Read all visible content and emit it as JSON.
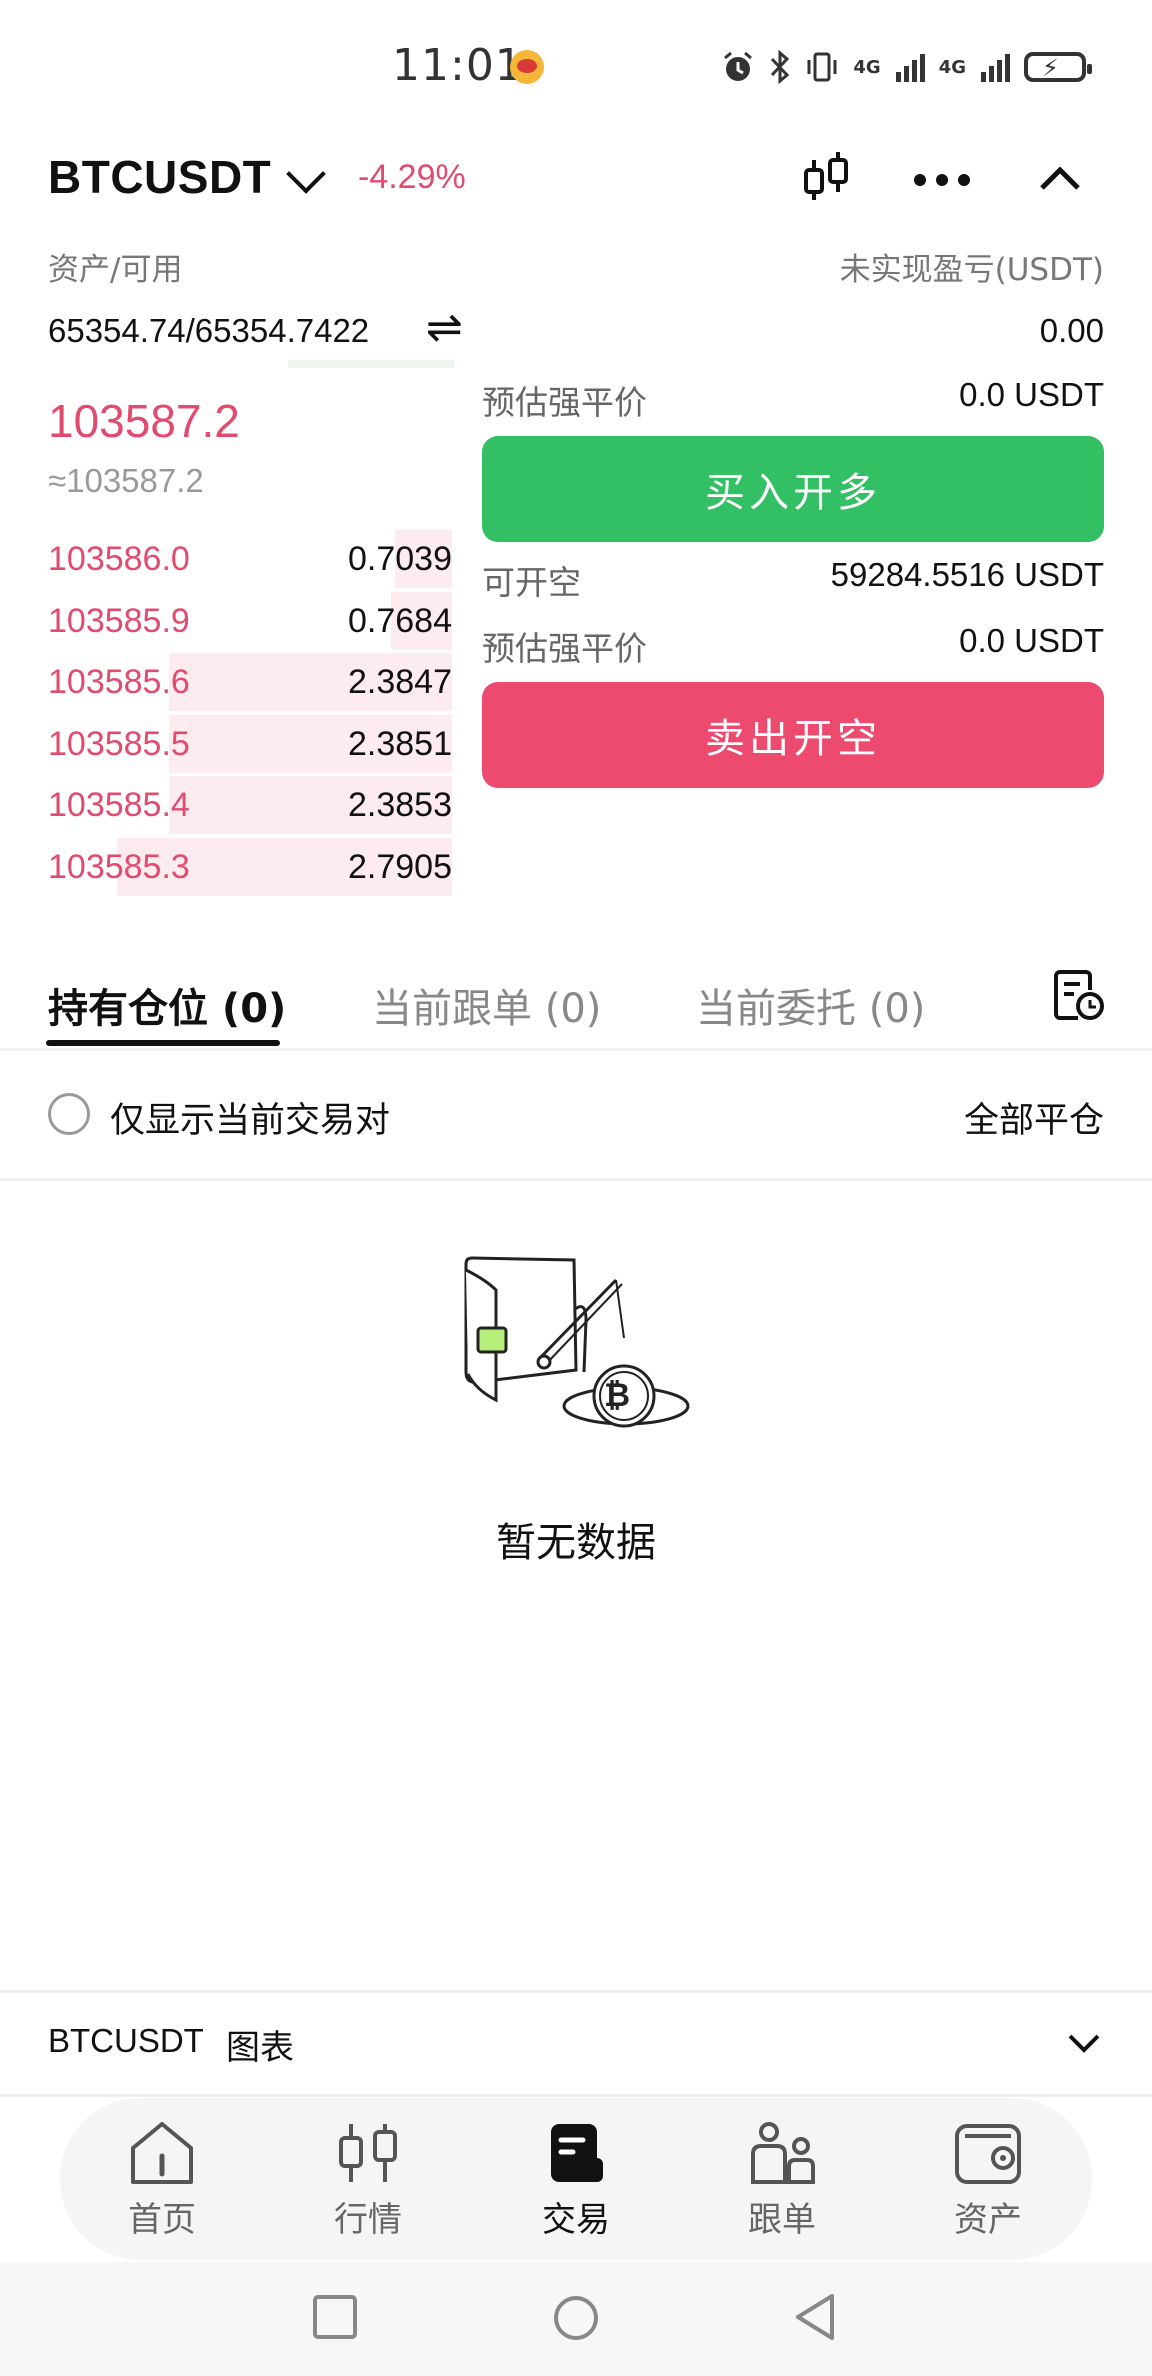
{
  "status_bar": {
    "time": "11:01",
    "signal_1": "4G",
    "signal_2": "4G"
  },
  "header": {
    "symbol": "BTCUSDT",
    "change": "-4.29%"
  },
  "account": {
    "assets_label": "资产/可用",
    "assets_value": "65354.74/65354.7422",
    "swap_glyph": "⇌",
    "pnl_label": "未实现盈亏(USDT)",
    "pnl_value": "0.00"
  },
  "price": {
    "last": "103587.2",
    "approx": "≈103587.2"
  },
  "order_book": [
    {
      "price": "103586.0",
      "qty": "0.7039",
      "depth": 0.14
    },
    {
      "price": "103585.9",
      "qty": "0.7684",
      "depth": 0.15
    },
    {
      "price": "103585.6",
      "qty": "2.3847",
      "depth": 0.7
    },
    {
      "price": "103585.5",
      "qty": "2.3851",
      "depth": 0.7
    },
    {
      "price": "103585.4",
      "qty": "2.3853",
      "depth": 0.7
    },
    {
      "price": "103585.3",
      "qty": "2.7905",
      "depth": 0.83
    }
  ],
  "trade": {
    "liq_label_1": "预估强平价",
    "liq_value_1": "0.0 USDT",
    "buy_label": "买入开多",
    "short_label": "可开空",
    "short_value": "59284.5516 USDT",
    "liq_label_2": "预估强平价",
    "liq_value_2": "0.0 USDT",
    "sell_label": "卖出开空"
  },
  "tabs": [
    {
      "label": "持有仓位 (0)",
      "active": true
    },
    {
      "label": "当前跟单 (0)",
      "active": false
    },
    {
      "label": "当前委托 (0)",
      "active": false
    }
  ],
  "filters": {
    "only_current_pair": "仅显示当前交易对",
    "close_all": "全部平仓"
  },
  "empty_state": {
    "text": "暂无数据",
    "coin_symbol": "₿"
  },
  "chart_bar": {
    "symbol": "BTCUSDT",
    "label": "图表"
  },
  "bottom_nav": [
    {
      "label": "首页",
      "icon": "home-icon",
      "active": false
    },
    {
      "label": "行情",
      "icon": "candlestick-icon",
      "active": false
    },
    {
      "label": "交易",
      "icon": "trade-icon",
      "active": true
    },
    {
      "label": "跟单",
      "icon": "copy-trade-icon",
      "active": false
    },
    {
      "label": "资产",
      "icon": "wallet-icon",
      "active": false
    }
  ],
  "colors": {
    "up": "#33bf63",
    "down": "#ec4b6f",
    "depth_bg": "#fdecef"
  }
}
